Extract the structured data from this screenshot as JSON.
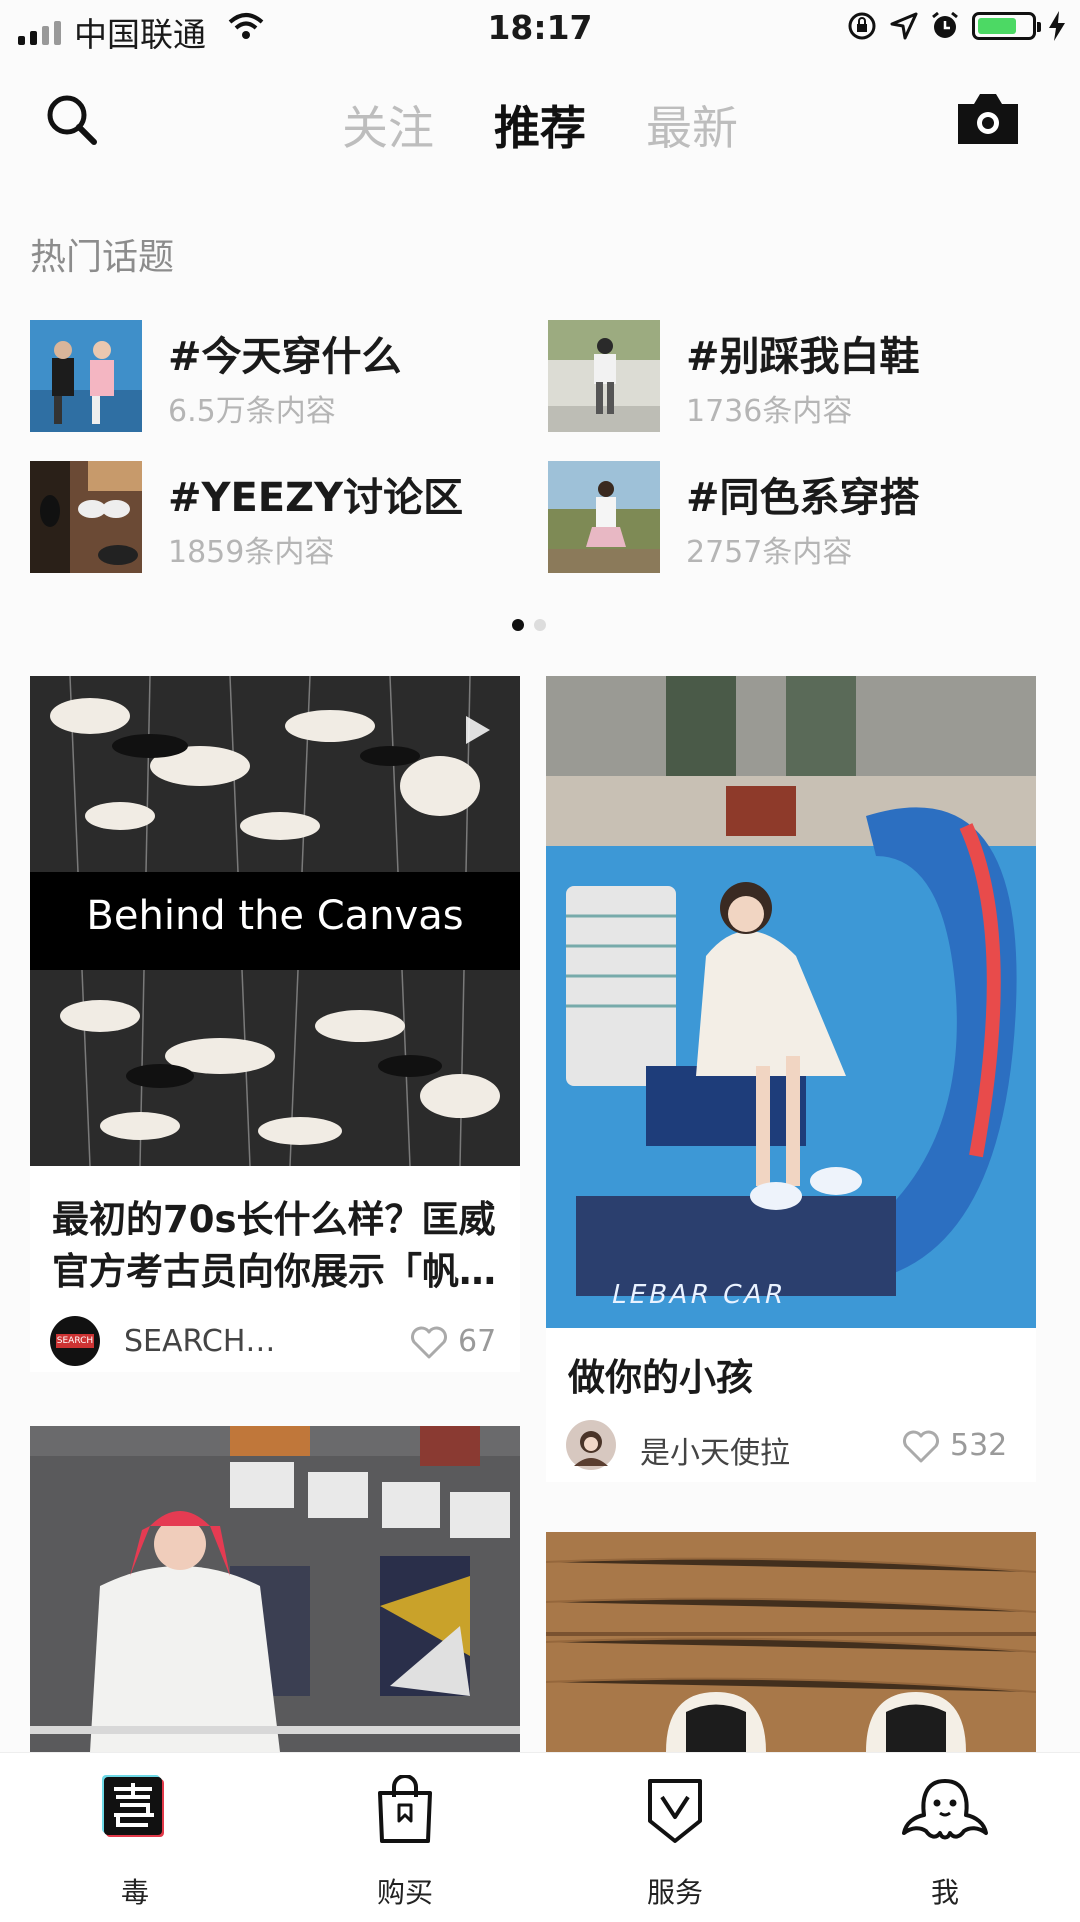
{
  "status_bar": {
    "carrier": "中国联通",
    "time": "18:17"
  },
  "nav": {
    "tabs": [
      {
        "label": "关注"
      },
      {
        "label": "推荐"
      },
      {
        "label": "最新"
      }
    ],
    "active_tab": "推荐"
  },
  "hot_topics": {
    "title": "热门话题",
    "items": [
      {
        "name": "#今天穿什么",
        "count": "6.5万条内容"
      },
      {
        "name": "#别踩我白鞋",
        "count": "1736条内容"
      },
      {
        "name": "#YEEZY讨论区",
        "count": "1859条内容"
      },
      {
        "name": "#同色系穿搭",
        "count": "2757条内容"
      }
    ],
    "page_count": 2,
    "active_page": 1
  },
  "feed": [
    {
      "image_text": "Behind the Canvas",
      "caption": "最初的70s长什么样？匡威官方考古员向你展示「帆…",
      "author": "SEARCH…",
      "avatar_text": "SEARCH",
      "likes": "67"
    },
    {
      "image_text": "LEBAR CAR",
      "caption": "做你的小孩",
      "author": "是小天使拉",
      "likes": "532"
    },
    {
      "image_text": "",
      "caption": "",
      "author": "",
      "likes": ""
    },
    {
      "image_text": "",
      "caption": "",
      "author": "",
      "likes": ""
    }
  ],
  "bottom_nav": [
    {
      "label": "毒",
      "icon": "du-logo-icon"
    },
    {
      "label": "购买",
      "icon": "shopping-bag-icon"
    },
    {
      "label": "服务",
      "icon": "shield-check-icon"
    },
    {
      "label": "我",
      "icon": "octopus-icon"
    }
  ],
  "colors": {
    "accent": "#111111",
    "inactive_tab": "#bdbdbd",
    "battery": "#4cd964",
    "muted_text": "#b5b5b5"
  }
}
